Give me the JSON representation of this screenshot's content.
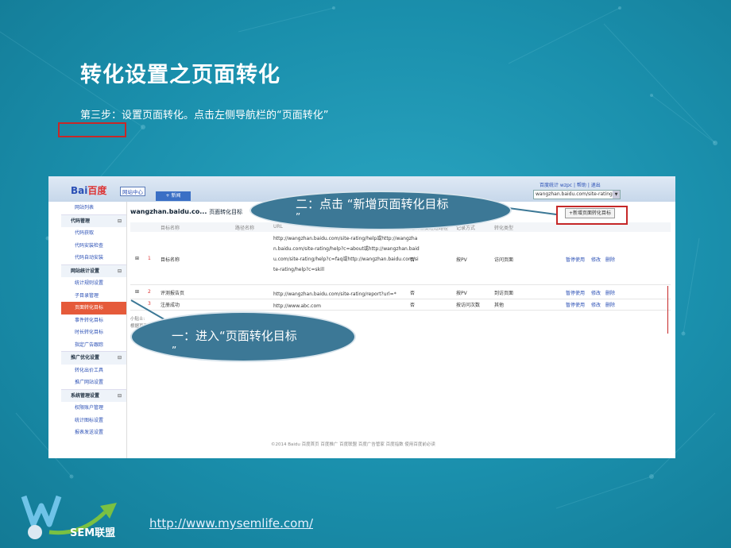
{
  "slide": {
    "title": "转化设置之页面转化",
    "subtitle": "第三步：设置页面转化。点击左侧导航栏的“页面转化”",
    "url": "http://www.mysemlife.com/",
    "brand": "SEM联盟"
  },
  "app": {
    "logo_a": "Bai",
    "logo_b": "百度",
    "site_center": "网站中心",
    "new_button": "+ 新闻",
    "top_links": "百度统计   wzpc  |  帮助  |  退出",
    "domain": "wangzhan.baidu.com/site-rating",
    "breadcrumb_site": "wangzhan.baidu.co...",
    "breadcrumb_page": "页面转化目标",
    "add_button": "+新增页面转化目标",
    "tips_line1": "小贴士:",
    "tips_line2": "根据页面转化...",
    "footer": "©2014 Baidu 百度首页  百度推广  百度联盟  百度广告管家  百度指数  使用百度前必读"
  },
  "sidebar": {
    "items": [
      {
        "label": "网站列表",
        "type": "item"
      },
      {
        "label": "代码管理",
        "type": "group"
      },
      {
        "label": "代码获取",
        "type": "item"
      },
      {
        "label": "代码安装检查",
        "type": "item"
      },
      {
        "label": "代码自动安装",
        "type": "item"
      },
      {
        "label": "网站统计设置",
        "type": "group"
      },
      {
        "label": "统计规则设置",
        "type": "item"
      },
      {
        "label": "子目录管理",
        "type": "item"
      },
      {
        "label": "页面转化目标",
        "type": "active"
      },
      {
        "label": "事件转化目标",
        "type": "item"
      },
      {
        "label": "时长转化目标",
        "type": "item"
      },
      {
        "label": "指定广告跟踪",
        "type": "item"
      },
      {
        "label": "推广优化设置",
        "type": "group"
      },
      {
        "label": "转化出价工具",
        "type": "item"
      },
      {
        "label": "推广网站设置",
        "type": "item"
      },
      {
        "label": "系统管理设置",
        "type": "group"
      },
      {
        "label": "权限账户管理",
        "type": "item"
      },
      {
        "label": "统计图标设置",
        "type": "item"
      },
      {
        "label": "报表发送设置",
        "type": "item"
      }
    ]
  },
  "table": {
    "headers": [
      "目标名称",
      "路径名称",
      "URL",
      "是否需要经过路径",
      "记录方式",
      "转化类型"
    ],
    "rows": [
      {
        "expand": "⊞",
        "idx": "1",
        "name": "目标名称",
        "url_lines": [
          "http://wangzhan.baidu.com/site-rating/help或http://wangzha",
          "n.baidu.com/site-rating/help?c=about或http://wangzhan.baid",
          "u.com/site-rating/help?c=faq或http://wangzhan.baidu.com/si",
          "te-rating/help?c=skill"
        ],
        "path": "否",
        "record": "按PV",
        "type": "访问页面",
        "actions": [
          "暂停使用",
          "修改",
          "删除"
        ]
      },
      {
        "expand": "⊞",
        "idx": "2",
        "name": "评测报告页",
        "url_lines": [
          "http://wangzhan.baidu.com/site-rating/report?url=*"
        ],
        "path": "否",
        "record": "按PV",
        "type": "到访页面",
        "actions": [
          "暂停使用",
          "修改",
          "删除"
        ]
      },
      {
        "expand": "",
        "idx": "3",
        "name": "注册成功",
        "url_lines": [
          "http://www.abc.com"
        ],
        "path": "否",
        "record": "按访问次数",
        "type": "其他",
        "actions": [
          "暂停使用",
          "修改",
          "删除"
        ]
      }
    ]
  },
  "callouts": {
    "one": {
      "text": "一：进入“页面转化目标",
      "quote": "”"
    },
    "two": {
      "text": "二：点击 “新增页面转化目标",
      "quote": "”"
    }
  },
  "colors": {
    "background": "#1a8fac",
    "highlight": "#c62828",
    "callout": "#3c7896",
    "link": "#2a4fb5"
  }
}
